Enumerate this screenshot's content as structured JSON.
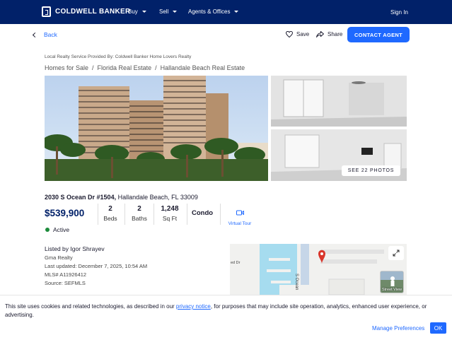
{
  "header": {
    "brand": "COLDWELL BANKER",
    "nav": [
      {
        "label": "Buy"
      },
      {
        "label": "Sell"
      },
      {
        "label": "Agents & Offices"
      }
    ],
    "signin": "Sign In"
  },
  "actions": {
    "back": "Back",
    "save": "Save",
    "share": "Share",
    "contact": "CONTACT AGENT"
  },
  "provider": "Local Realty Service Provided By: Coldwell Banker Home Lovers Realty",
  "breadcrumbs": [
    "Homes for Sale",
    "Florida Real Estate",
    "Hallandale Beach Real Estate"
  ],
  "gallery": {
    "see_photos": "SEE 22 PHOTOS"
  },
  "listing": {
    "street": "2030 S Ocean Dr #1504,",
    "city": "Hallandale Beach, FL 33009",
    "price": "$539,900",
    "beds": {
      "value": "2",
      "label": "Beds"
    },
    "baths": {
      "value": "2",
      "label": "Baths"
    },
    "sqft": {
      "value": "1,248",
      "label": "Sq Ft"
    },
    "type": "Condo",
    "virtual_tour": "Virtual Tour",
    "status": "Active",
    "status_color": "#1c8b3b"
  },
  "agent": {
    "listed_by": "Listed by Igor Shrayev",
    "office": "Gma Realty",
    "updated": "Last updated: December 7, 2025, 10:54 AM",
    "mls": "MLS# A11926412",
    "source": "Source: SEFMLS"
  },
  "map": {
    "street_label": "S Ocean",
    "side_label": "ed Dr",
    "streetview": "Street View"
  },
  "cookie": {
    "text_before": "This site uses cookies and related technologies, as described in our ",
    "link": "privacy notice",
    "text_after": ", for purposes that may include site operation, analytics, enhanced user experience, or advertising.",
    "manage": "Manage Preferences",
    "ok": "OK"
  },
  "colors": {
    "brand_navy": "#012169",
    "accent_blue": "#1f69ff"
  }
}
